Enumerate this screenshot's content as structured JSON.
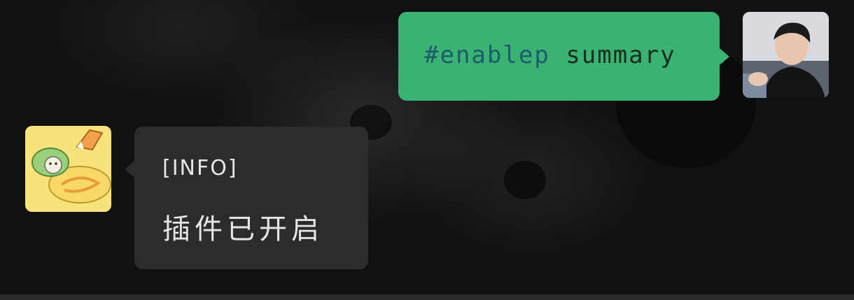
{
  "chat": {
    "messages": [
      {
        "sender": "user",
        "command_tag": "#enablep",
        "command_arg": "summary"
      },
      {
        "sender": "bot",
        "label": "[INFO]",
        "text": "插件已开启"
      }
    ]
  },
  "colors": {
    "user_bubble": "#3ab372",
    "bot_bubble": "#2c2c2c",
    "background": "#121212",
    "text_light": "#e6e6e6",
    "tag_color": "#1d5a6e"
  },
  "icons": {
    "user_avatar": "user-avatar-photo",
    "bot_avatar": "bot-avatar-sticker"
  }
}
